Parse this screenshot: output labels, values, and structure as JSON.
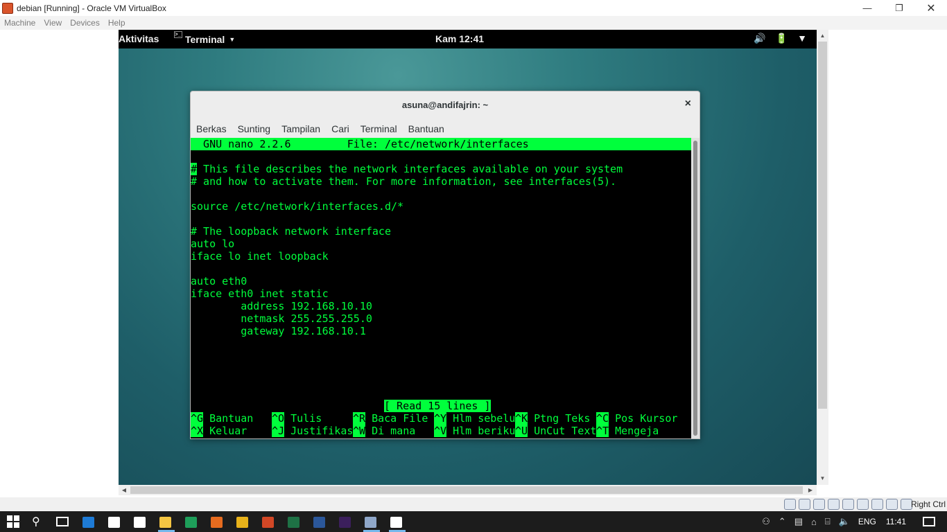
{
  "vbox": {
    "title": "debian [Running] - Oracle VM VirtualBox",
    "menu": [
      "Machine",
      "View",
      "Devices",
      "Help"
    ],
    "controls": {
      "minimize": "—",
      "maximize": "❐",
      "close": "✕"
    },
    "host_key": "Right Ctrl"
  },
  "gnome": {
    "activities": "Aktivitas",
    "app_menu": "Terminal",
    "app_menu_arrow": "▼",
    "clock": "Kam 12:41",
    "tray": {
      "volume": "🔊",
      "power": "🔋",
      "arrow": "▼"
    }
  },
  "terminal": {
    "title": "asuna@andifajrin: ~",
    "close": "×",
    "menu": [
      "Berkas",
      "Sunting",
      "Tampilan",
      "Cari",
      "Terminal",
      "Bantuan"
    ],
    "nano_header": "  GNU nano 2.2.6         File: /etc/network/interfaces",
    "cursor_char": "#",
    "lines": [
      " This file describes the network interfaces available on your system",
      "# and how to activate them. For more information, see interfaces(5).",
      "",
      "source /etc/network/interfaces.d/*",
      "",
      "# The loopback network interface",
      "auto lo",
      "iface lo inet loopback",
      "",
      "auto eth0",
      "iface eth0 inet static",
      "        address 192.168.10.10",
      "        netmask 255.255.255.0",
      "        gateway 192.168.10.1"
    ],
    "status": "[ Read 15 lines ]",
    "shortcuts_row1": [
      {
        "key": "^G",
        "label": " Bantuan   "
      },
      {
        "key": "^O",
        "label": " Tulis     "
      },
      {
        "key": "^R",
        "label": " Baca File "
      },
      {
        "key": "^Y",
        "label": " Hlm sebelu"
      },
      {
        "key": "^K",
        "label": " Ptng Teks "
      },
      {
        "key": "^C",
        "label": " Pos Kursor"
      }
    ],
    "shortcuts_row2": [
      {
        "key": "^X",
        "label": " Keluar    "
      },
      {
        "key": "^J",
        "label": " Justifikas"
      },
      {
        "key": "^W",
        "label": " Di mana   "
      },
      {
        "key": "^V",
        "label": " Hlm beriku"
      },
      {
        "key": "^U",
        "label": " UnCut Text"
      },
      {
        "key": "^T",
        "label": " Mengeja"
      }
    ]
  },
  "taskbar": {
    "search_icon": "⚲",
    "lang": "ENG",
    "time": "11:41",
    "tray_icons": [
      "⚇",
      "⌃",
      "▤",
      "⌂",
      "⌸",
      "🔈"
    ],
    "apps": [
      {
        "name": "edge-icon",
        "color": "#1e7bd6"
      },
      {
        "name": "mail-icon",
        "color": "#ffffff"
      },
      {
        "name": "store-icon",
        "color": "#ffffff"
      },
      {
        "name": "file-explorer-icon",
        "color": "#f4c542"
      },
      {
        "name": "spreadsheet-icon",
        "color": "#1e9e5a"
      },
      {
        "name": "firefox-icon",
        "color": "#e66b1f"
      },
      {
        "name": "chrome-icon",
        "color": "#e8b21a"
      },
      {
        "name": "powerpoint-icon",
        "color": "#d24726"
      },
      {
        "name": "excel-icon",
        "color": "#1e7145"
      },
      {
        "name": "word-icon",
        "color": "#2b579a"
      },
      {
        "name": "premiere-icon",
        "color": "#3b1f5c"
      },
      {
        "name": "virtualbox-icon",
        "color": "#8fa7c9"
      },
      {
        "name": "photos-icon",
        "color": "#ffffff"
      }
    ]
  }
}
